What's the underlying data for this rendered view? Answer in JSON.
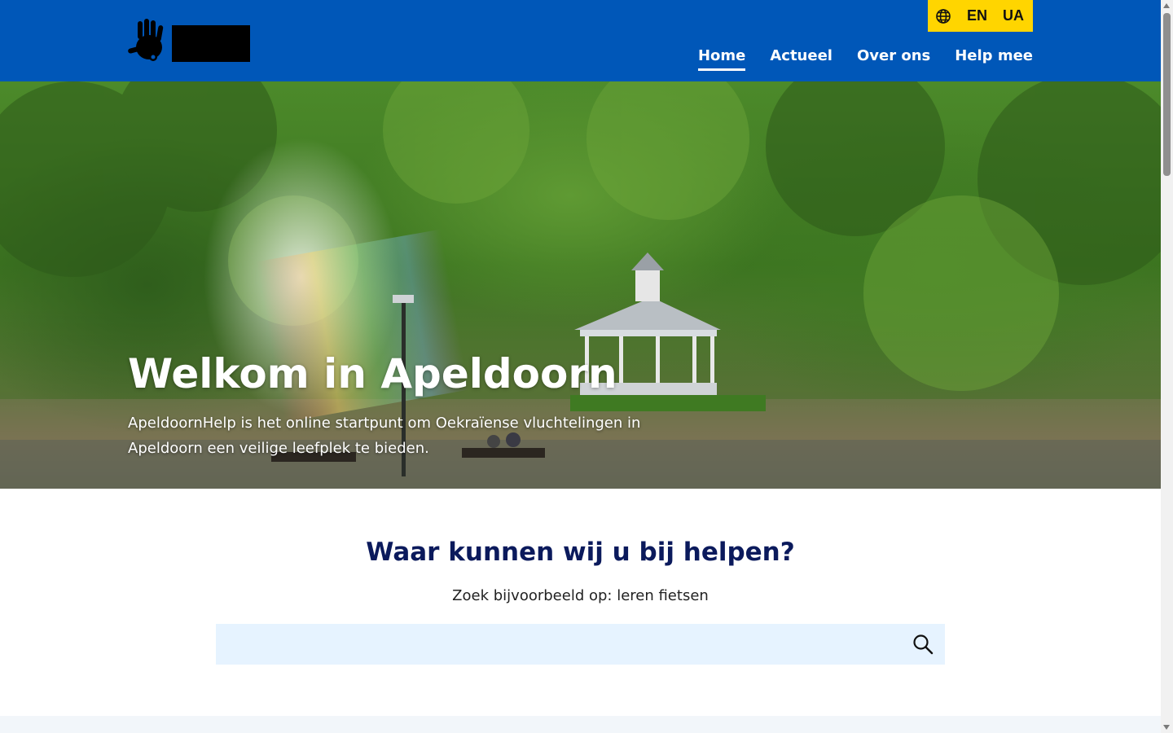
{
  "header": {
    "language_switch": {
      "icon": "globe-icon",
      "options": [
        "EN",
        "UA"
      ]
    },
    "nav": [
      {
        "label": "Home",
        "active": true
      },
      {
        "label": "Actueel",
        "active": false
      },
      {
        "label": "Over ons",
        "active": false
      },
      {
        "label": "Help mee",
        "active": false
      }
    ],
    "colors": {
      "background": "#0057b8",
      "language_switch_background": "#ffd500"
    }
  },
  "hero": {
    "title": "Welkom in Apeldoorn",
    "subtitle": "ApeldoornHelp is het online startpunt om Oekraïense vluchtelingen in Apeldoorn een veilige leefplek te bieden."
  },
  "search": {
    "heading": "Waar kunnen wij u bij helpen?",
    "hint": "Zoek bijvoorbeeld op: leren fietsen",
    "value": "",
    "placeholder": "",
    "button_icon": "search-icon",
    "colors": {
      "heading": "#0b1a5c",
      "field_background": "#e6f3ff"
    }
  }
}
